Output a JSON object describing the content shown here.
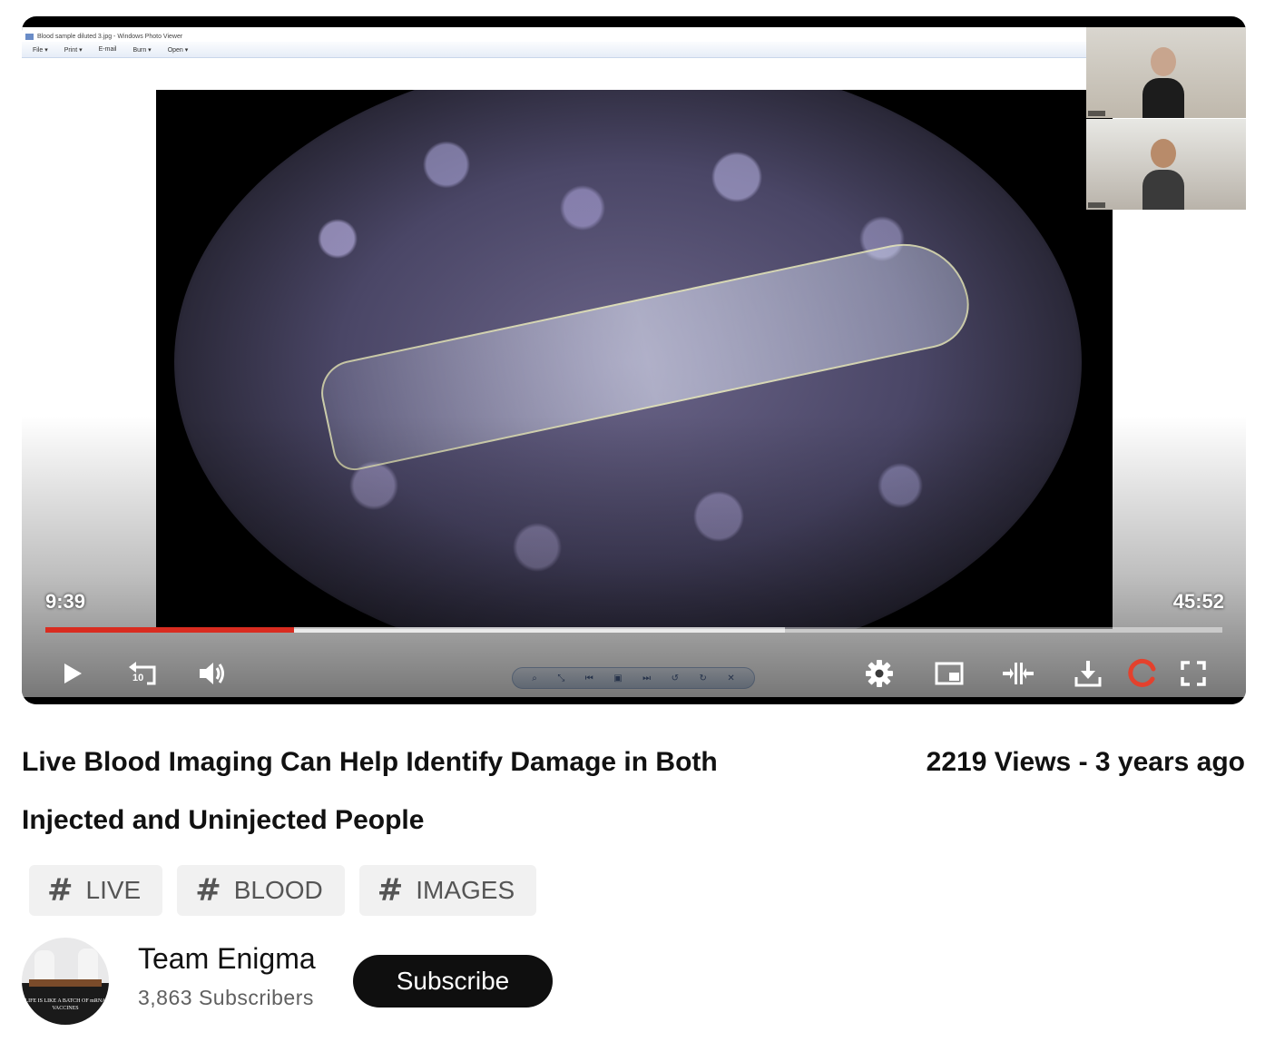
{
  "player": {
    "current_time": "9:39",
    "duration": "45:52",
    "progress_fraction": 0.211,
    "buffered_fraction": 0.628,
    "progress_color": "#d92c20",
    "replay_seconds": "10",
    "controls": {
      "play_icon": "play-icon",
      "replay_icon": "replay-10-icon",
      "volume_icon": "volume-icon",
      "settings_icon": "gear-icon",
      "miniplayer_icon": "miniplayer-icon",
      "theater_icon": "theater-mode-icon",
      "download_icon": "download-icon",
      "loading_icon": "loading-spinner-icon",
      "fullscreen_icon": "fullscreen-icon"
    },
    "loading_color": "#e4412d"
  },
  "video": {
    "title": "Live Blood Imaging Can Help Identify Damage in Both Injected and Uninjected People",
    "views_line": "2219 Views - 3 years ago"
  },
  "tags": [
    {
      "label": "LIVE"
    },
    {
      "label": "BLOOD"
    },
    {
      "label": "IMAGES"
    }
  ],
  "channel": {
    "name": "Team Enigma",
    "subscribers": "3,863 Subscribers",
    "subscribe_label": "Subscribe",
    "avatar_caption": "LIFE IS LIKE A BATCH OF mRNA VACCINES"
  }
}
